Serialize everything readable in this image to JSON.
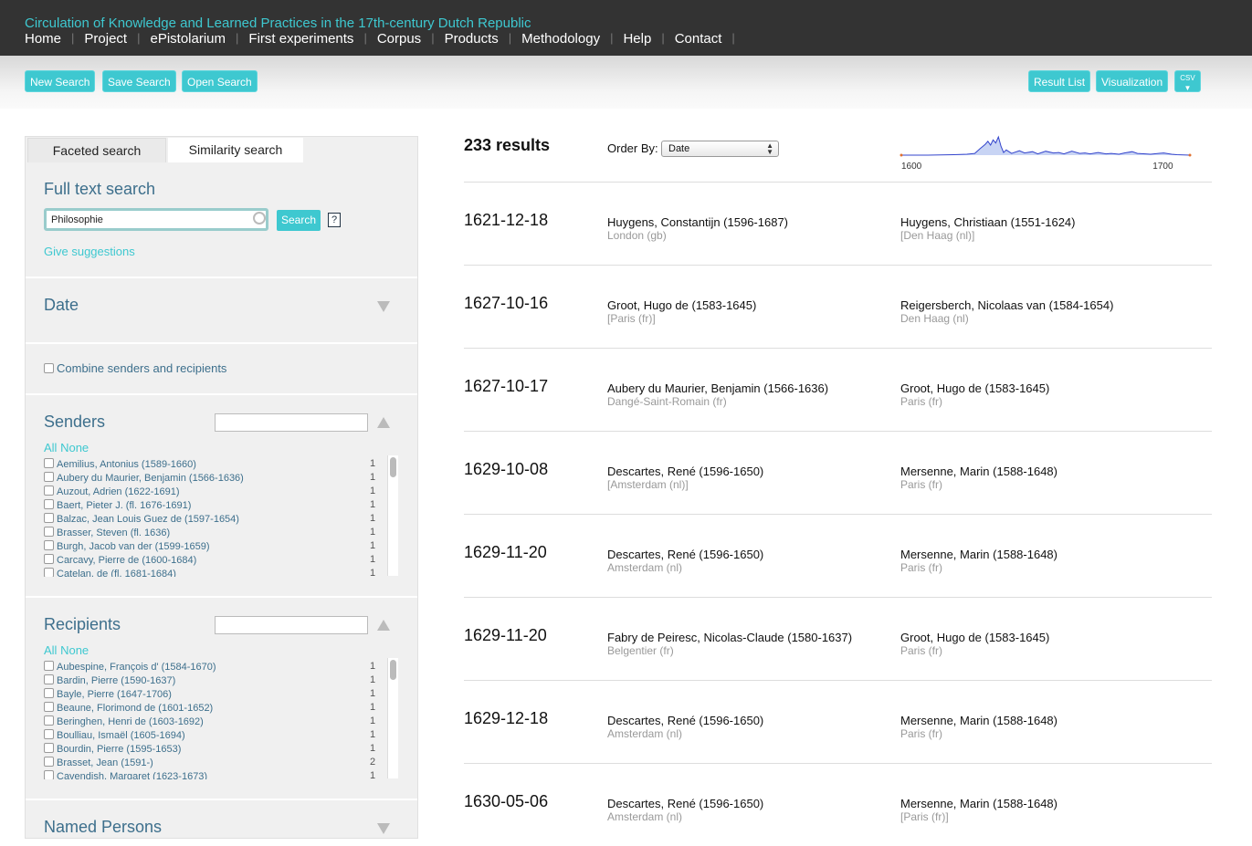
{
  "header": {
    "site_title": "Circulation of Knowledge and Learned Practices in the 17th-century Dutch Republic",
    "nav": [
      "Home",
      "Project",
      "ePistolarium",
      "First experiments",
      "Corpus",
      "Products",
      "Methodology",
      "Help",
      "Contact"
    ]
  },
  "toolbar": {
    "new_search": "New Search",
    "save_search": "Save Search",
    "open_search": "Open Search",
    "result_list": "Result List",
    "visualization": "Visualization",
    "csv": "CSV"
  },
  "tabs": {
    "faceted": "Faceted search",
    "similarity": "Similarity search"
  },
  "fulltext": {
    "title": "Full text search",
    "value": "Philosophie",
    "button": "Search",
    "help": "?",
    "suggest": "Give suggestions"
  },
  "date_section": {
    "title": "Date"
  },
  "combine": {
    "label": "Combine senders and recipients"
  },
  "senders": {
    "title": "Senders",
    "all": "All",
    "none": "None",
    "items": [
      {
        "name": "Aemilius, Antonius (1589-1660)",
        "count": "1"
      },
      {
        "name": "Aubery du Maurier, Benjamin (1566-1636)",
        "count": "1"
      },
      {
        "name": "Auzout, Adrien (1622-1691)",
        "count": "1"
      },
      {
        "name": "Baert, Pieter J. (fl. 1676-1691)",
        "count": "1"
      },
      {
        "name": "Balzac, Jean Louis Guez de (1597-1654)",
        "count": "1"
      },
      {
        "name": "Brasser, Steven (fl. 1636)",
        "count": "1"
      },
      {
        "name": "Burgh, Jacob van der (1599-1659)",
        "count": "1"
      },
      {
        "name": "Carcavy, Pierre de (1600-1684)",
        "count": "1"
      },
      {
        "name": "Catelan, de (fl. 1681-1684)",
        "count": "1"
      }
    ]
  },
  "recipients": {
    "title": "Recipients",
    "all": "All",
    "none": "None",
    "items": [
      {
        "name": "Aubespine, François d' (1584-1670)",
        "count": "1"
      },
      {
        "name": "Bardin, Pierre (1590-1637)",
        "count": "1"
      },
      {
        "name": "Bayle, Pierre (1647-1706)",
        "count": "1"
      },
      {
        "name": "Beaune, Florimond de (1601-1652)",
        "count": "1"
      },
      {
        "name": "Beringhen, Henri de (1603-1692)",
        "count": "1"
      },
      {
        "name": "Boulliau, Ismaël (1605-1694)",
        "count": "1"
      },
      {
        "name": "Bourdin, Pierre (1595-1653)",
        "count": "1"
      },
      {
        "name": "Brasset, Jean (1591-)",
        "count": "2"
      },
      {
        "name": "Cavendish, Margaret (1623-1673)",
        "count": "1"
      }
    ]
  },
  "named_persons": {
    "title": "Named Persons"
  },
  "results": {
    "count_label": "233 results",
    "order_by_label": "Order By:",
    "order_by_value": "Date",
    "timeline": {
      "x_start_label": "1600",
      "x_end_label": "1700",
      "x_range": [
        1600,
        1710
      ],
      "line_color": "#3344cc",
      "fill_color": "#c8d4f4",
      "points": [
        [
          1600,
          0
        ],
        [
          1610,
          0
        ],
        [
          1615,
          0.05
        ],
        [
          1620,
          0.1
        ],
        [
          1625,
          0.2
        ],
        [
          1628,
          0.4
        ],
        [
          1630,
          1.5
        ],
        [
          1631,
          2
        ],
        [
          1632,
          2.5
        ],
        [
          1633,
          3.2
        ],
        [
          1634,
          2.3
        ],
        [
          1635,
          3.5
        ],
        [
          1636,
          2.8
        ],
        [
          1637,
          4.2
        ],
        [
          1638,
          2
        ],
        [
          1639,
          0.6
        ],
        [
          1640,
          1.2
        ],
        [
          1642,
          0.4
        ],
        [
          1645,
          1
        ],
        [
          1647,
          0.5
        ],
        [
          1650,
          0.8
        ],
        [
          1652,
          0.3
        ],
        [
          1655,
          0.9
        ],
        [
          1658,
          0.5
        ],
        [
          1660,
          0.6
        ],
        [
          1662,
          0.3
        ],
        [
          1665,
          0.9
        ],
        [
          1668,
          0.4
        ],
        [
          1670,
          0.5
        ],
        [
          1672,
          0.3
        ],
        [
          1675,
          0.6
        ],
        [
          1678,
          0.3
        ],
        [
          1680,
          0.4
        ],
        [
          1683,
          0.2
        ],
        [
          1685,
          0.5
        ],
        [
          1688,
          0.8
        ],
        [
          1690,
          0.4
        ],
        [
          1693,
          0.3
        ],
        [
          1695,
          0.2
        ],
        [
          1700,
          0.5
        ],
        [
          1703,
          0.2
        ],
        [
          1705,
          0.1
        ],
        [
          1710,
          0
        ]
      ]
    },
    "rows": [
      {
        "date": "1621-12-18",
        "sender": "Huygens, Constantijn (1596-1687)",
        "sender_place": "London (gb)",
        "recipient": "Huygens, Christiaan (1551-1624)",
        "recipient_place": "[Den Haag (nl)]"
      },
      {
        "date": "1627-10-16",
        "sender": "Groot, Hugo de (1583-1645)",
        "sender_place": "[Paris (fr)]",
        "recipient": "Reigersberch, Nicolaas van (1584-1654)",
        "recipient_place": "Den Haag (nl)"
      },
      {
        "date": "1627-10-17",
        "sender": "Aubery du Maurier, Benjamin (1566-1636)",
        "sender_place": "Dangé-Saint-Romain (fr)",
        "recipient": "Groot, Hugo de (1583-1645)",
        "recipient_place": "Paris (fr)"
      },
      {
        "date": "1629-10-08",
        "sender": "Descartes, René (1596-1650)",
        "sender_place": "[Amsterdam (nl)]",
        "recipient": "Mersenne, Marin (1588-1648)",
        "recipient_place": "Paris (fr)"
      },
      {
        "date": "1629-11-20",
        "sender": "Descartes, René (1596-1650)",
        "sender_place": "Amsterdam (nl)",
        "recipient": "Mersenne, Marin (1588-1648)",
        "recipient_place": "Paris (fr)"
      },
      {
        "date": "1629-11-20",
        "sender": "Fabry de Peiresc, Nicolas-Claude (1580-1637)",
        "sender_place": "Belgentier (fr)",
        "recipient": "Groot, Hugo de (1583-1645)",
        "recipient_place": "Paris (fr)"
      },
      {
        "date": "1629-12-18",
        "sender": "Descartes, René (1596-1650)",
        "sender_place": "Amsterdam (nl)",
        "recipient": "Mersenne, Marin (1588-1648)",
        "recipient_place": "Paris (fr)"
      },
      {
        "date": "1630-05-06",
        "sender": "Descartes, René (1596-1650)",
        "sender_place": "Amsterdam (nl)",
        "recipient": "Mersenne, Marin (1588-1648)",
        "recipient_place": "[Paris (fr)]"
      }
    ]
  }
}
